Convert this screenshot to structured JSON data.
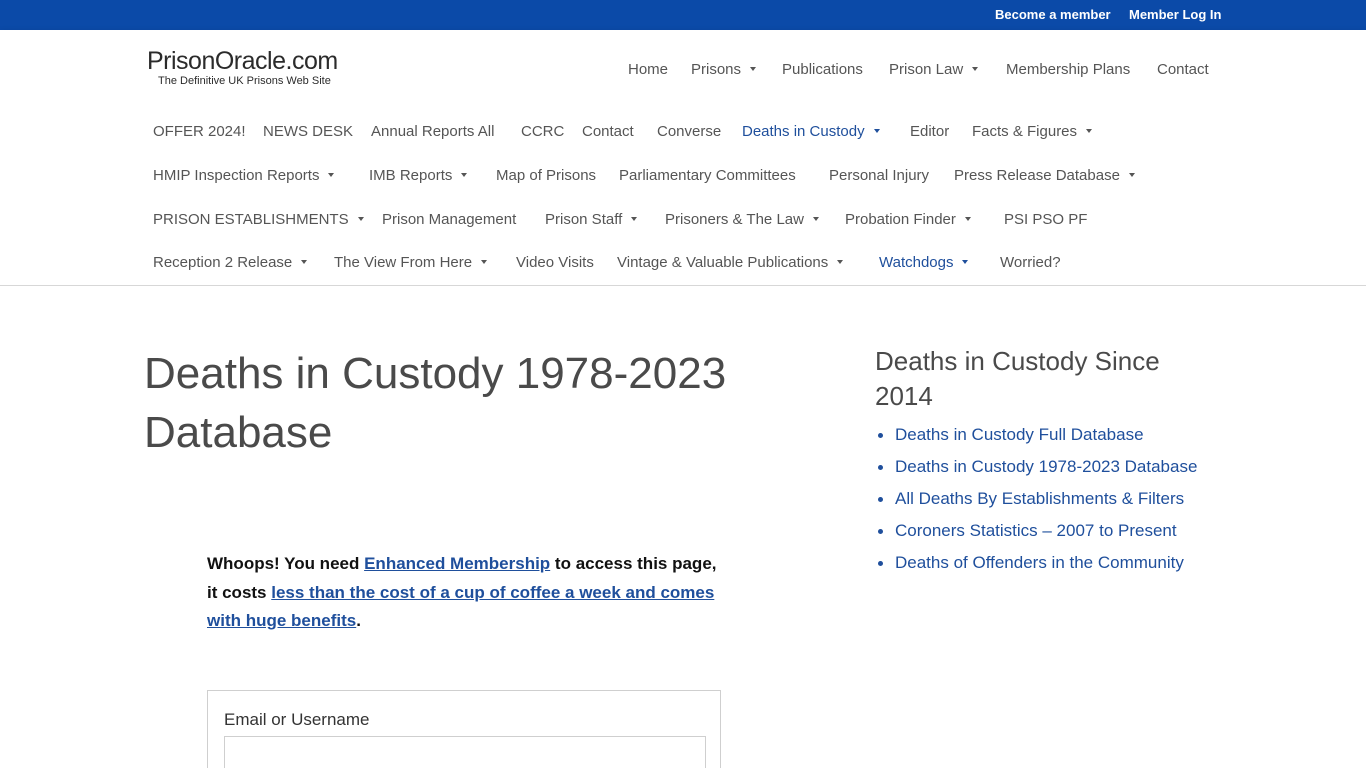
{
  "topbar": {
    "become_member": "Become a member",
    "member_login": "Member Log In"
  },
  "logo": {
    "name": "PrisonOracle.com",
    "tagline": "The Definitive UK Prisons Web Site"
  },
  "main_nav": {
    "home": "Home",
    "prisons": "Prisons",
    "publications": "Publications",
    "prison_law": "Prison Law",
    "membership_plans": "Membership Plans",
    "contact": "Contact"
  },
  "sub_nav": {
    "offer": "OFFER 2024!",
    "news_desk": "NEWS DESK",
    "annual_reports": "Annual Reports All",
    "ccrc": "CCRC",
    "contact": "Contact",
    "converse": "Converse",
    "deaths_in_custody": "Deaths in Custody",
    "editor": "Editor",
    "facts_figures": "Facts & Figures",
    "hmip": "HMIP Inspection Reports",
    "imb": "IMB Reports",
    "map_of_prisons": "Map of Prisons",
    "parliamentary": "Parliamentary Committees",
    "personal_injury": "Personal Injury",
    "press_release": "Press Release Database",
    "establishments": "PRISON ESTABLISHMENTS",
    "prison_management": "Prison Management",
    "prison_staff": "Prison Staff",
    "prisoners_law": "Prisoners & The Law",
    "probation_finder": "Probation Finder",
    "psi_pso": "PSI PSO PF",
    "reception": "Reception 2 Release",
    "view_from_here": "The View From Here",
    "video_visits": "Video Visits",
    "vintage": "Vintage & Valuable Publications",
    "watchdogs": "Watchdogs",
    "worried": "Worried?"
  },
  "main": {
    "title": "Deaths in Custody 1978-2023 Database",
    "notice_prefix": "Whoops! You need ",
    "notice_link1": "Enhanced Membership",
    "notice_mid": " to access this page, it costs ",
    "notice_link2": "less than the cost of a cup of coffee a week and comes with huge benefits",
    "notice_suffix": ".",
    "login_label": "Email or Username",
    "login_value": ""
  },
  "sidebar": {
    "title": "Deaths in Custody Since 2014",
    "links": [
      "Deaths in Custody Full Database",
      "Deaths in Custody 1978-2023 Database",
      "All Deaths By Establishments & Filters",
      "Coroners Statistics – 2007 to Present",
      "Deaths of Offenders in the Community"
    ]
  },
  "colors": {
    "topbar": "#0b4aa8",
    "link": "#1f4f9c",
    "text": "#4a4a4a"
  }
}
